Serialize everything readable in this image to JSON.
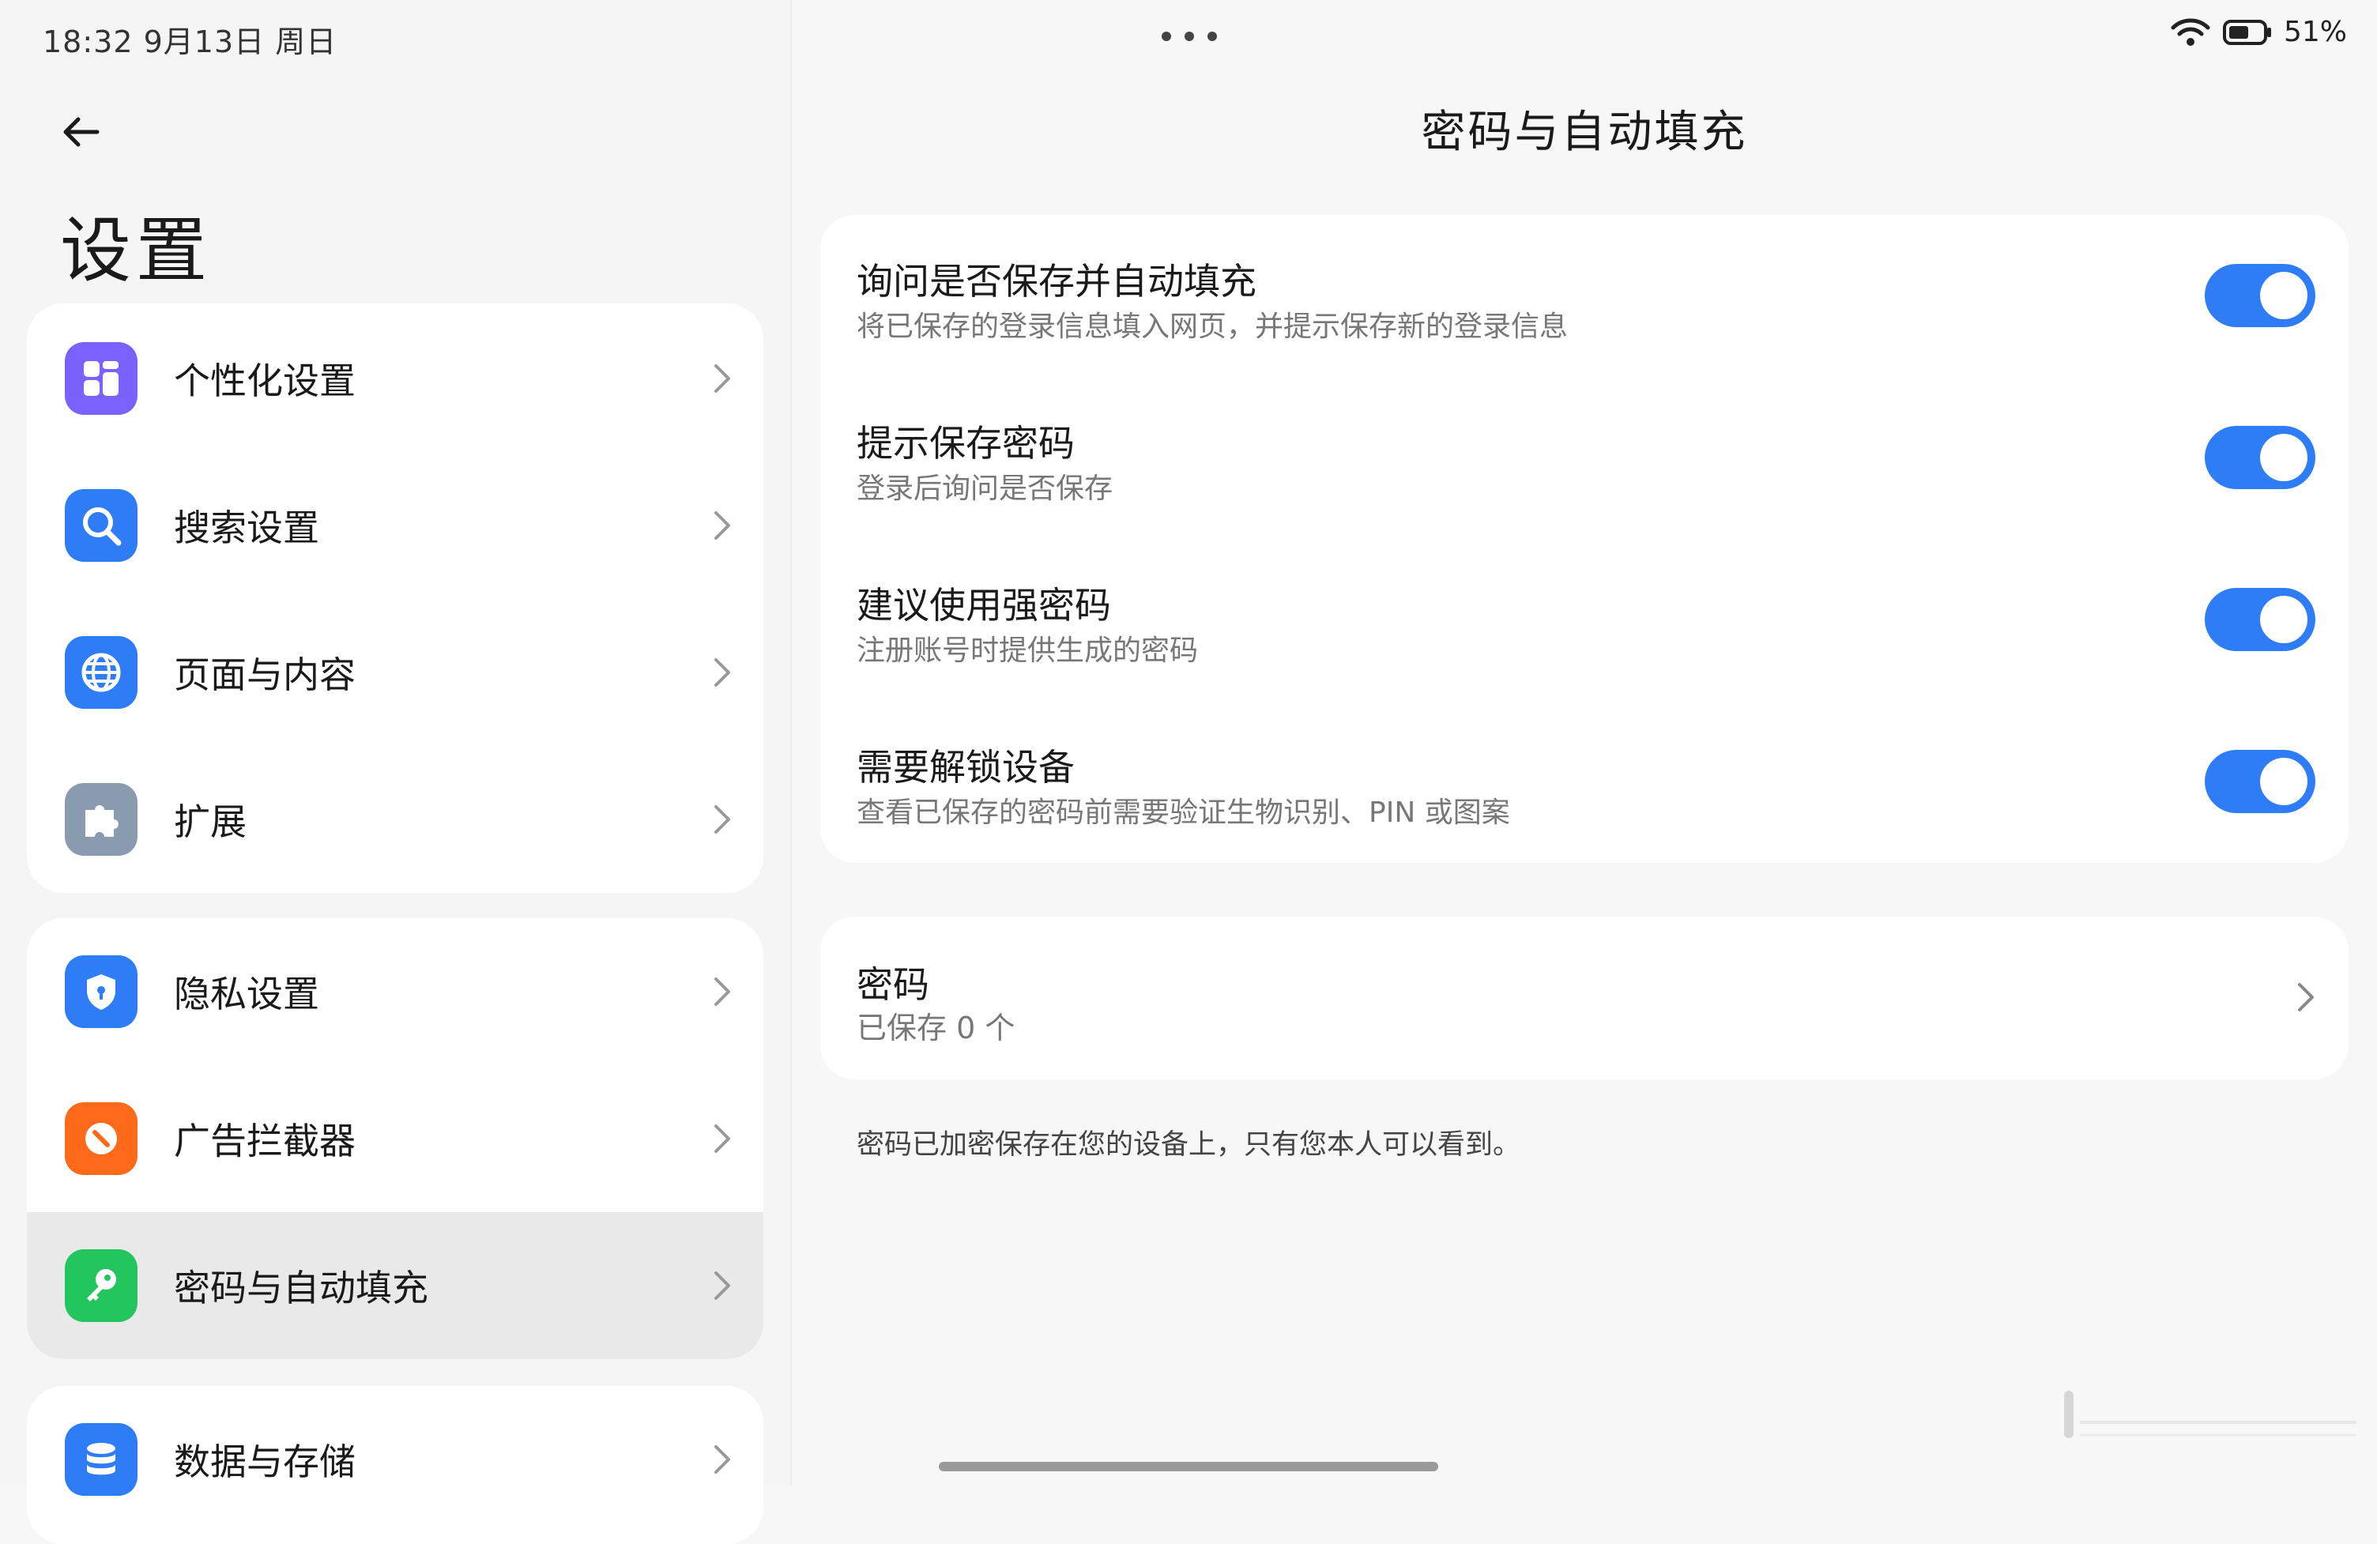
{
  "status_bar": {
    "time_date": "18:32  9月13日 周日",
    "battery_percent": "51%",
    "icons": [
      "wifi-icon",
      "battery-icon"
    ]
  },
  "left": {
    "title": "设置",
    "groups": [
      {
        "items": [
          {
            "label": "个性化设置",
            "icon": "personalization-icon",
            "color": "#7b61ff"
          },
          {
            "label": "搜索设置",
            "icon": "search-icon",
            "color": "#2f7df6"
          },
          {
            "label": "页面与内容",
            "icon": "globe-icon",
            "color": "#2f7df6"
          },
          {
            "label": "扩展",
            "icon": "puzzle-icon",
            "color": "#8a9bb0"
          }
        ]
      },
      {
        "items": [
          {
            "label": "隐私设置",
            "icon": "shield-icon",
            "color": "#2f7df6"
          },
          {
            "label": "广告拦截器",
            "icon": "adblock-icon",
            "color": "#ff6a1a"
          },
          {
            "label": "密码与自动填充",
            "icon": "key-icon",
            "color": "#22c55e",
            "selected": true
          }
        ]
      },
      {
        "items": [
          {
            "label": "数据与存储",
            "icon": "database-icon",
            "color": "#2f7df6"
          }
        ]
      }
    ]
  },
  "detail": {
    "title": "密码与自动填充",
    "toggles": [
      {
        "title": "询问是否保存并自动填充",
        "desc": "将已保存的登录信息填入网页，并提示保存新的登录信息",
        "on": true
      },
      {
        "title": "提示保存密码",
        "desc": "登录后询问是否保存",
        "on": true
      },
      {
        "title": "建议使用强密码",
        "desc": "注册账号时提供生成的密码",
        "on": true
      },
      {
        "title": "需要解锁设备",
        "desc": "查看已保存的密码前需要验证生物识别、PIN 或图案",
        "on": true
      }
    ],
    "passwords": {
      "title": "密码",
      "count": "已保存 0 个"
    },
    "footer_note": "密码已加密保存在您的设备上，只有您本人可以看到。"
  },
  "colors": {
    "accent": "#2f7df6",
    "selected_bg": "#e9e9e9"
  }
}
